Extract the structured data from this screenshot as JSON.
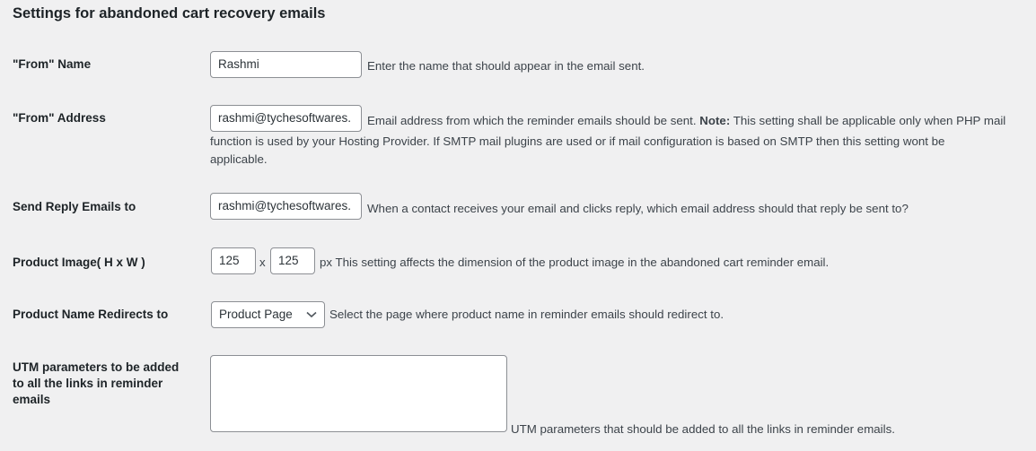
{
  "title": "Settings for abandoned cart recovery emails",
  "from_name": {
    "label": "\"From\" Name",
    "value": "Rashmi",
    "desc": "Enter the name that should appear in the email sent."
  },
  "from_address": {
    "label": "\"From\" Address",
    "value": "rashmi@tychesoftwares.",
    "desc_1": "Email address from which the reminder emails should be sent.",
    "note_label": "Note:",
    "desc_2": "This setting shall be applicable only when PHP mail",
    "desc_3": "function is used by your Hosting Provider. If SMTP mail plugins are used or if mail configuration is based on SMTP then this setting wont be",
    "desc_4": "applicable."
  },
  "reply_to": {
    "label": "Send Reply Emails to",
    "value": "rashmi@tychesoftwares.",
    "desc": "When a contact receives your email and clicks reply, which email address should that reply be sent to?"
  },
  "product_image": {
    "label": "Product Image( H x W )",
    "height": "125",
    "sep": "x",
    "width": "125",
    "unit": "px",
    "desc": "This setting affects the dimension of the product image in the abandoned cart reminder email."
  },
  "redirect": {
    "label": "Product Name Redirects to",
    "selected": "Product Page",
    "desc": "Select the page where product name in reminder emails should redirect to."
  },
  "utm": {
    "label_1": "UTM parameters to be added",
    "label_2": "to all the links in reminder",
    "label_3": "emails",
    "value": "",
    "desc": "UTM parameters that should be added to all the links in reminder emails."
  }
}
